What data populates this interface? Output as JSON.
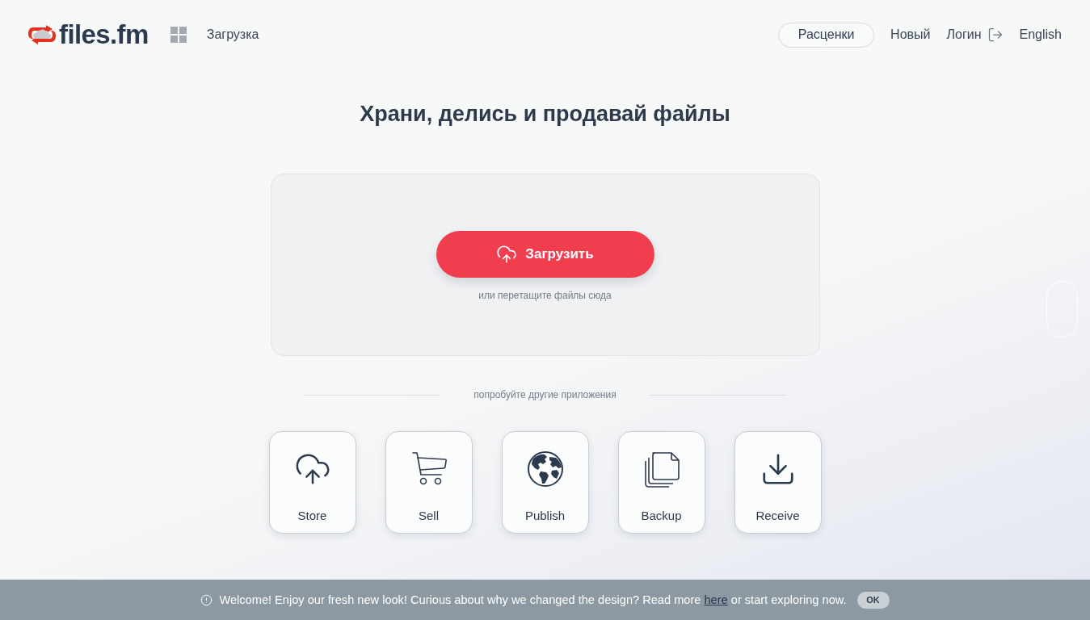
{
  "header": {
    "logo": {
      "text": "files.fm"
    },
    "nav": [
      {
        "label": "Загрузка"
      }
    ],
    "actions": [
      {
        "kind": "pill",
        "label": "Расценки"
      },
      {
        "kind": "link",
        "label": "Новый"
      },
      {
        "kind": "login",
        "label": "Логин"
      },
      {
        "kind": "link",
        "label": "English"
      }
    ]
  },
  "hero": {
    "title": "Храни, делись и продавай файлы"
  },
  "upload": {
    "button": "Загрузить",
    "hint": "или перетащите файлы сюда"
  },
  "apps": {
    "divider_label": "попробуйте другие приложения",
    "items": [
      {
        "kind": "store",
        "label": "Store"
      },
      {
        "kind": "sell",
        "label": "Sell"
      },
      {
        "kind": "publish",
        "label": "Publish"
      },
      {
        "kind": "backup",
        "label": "Backup"
      },
      {
        "kind": "receive",
        "label": "Receive"
      }
    ]
  },
  "notice": {
    "text_before": "Welcome! Enjoy our fresh new look! Curious about why we changed the design? Read more",
    "link": "here",
    "text_after": "or start exploring now.",
    "button": "OK"
  }
}
